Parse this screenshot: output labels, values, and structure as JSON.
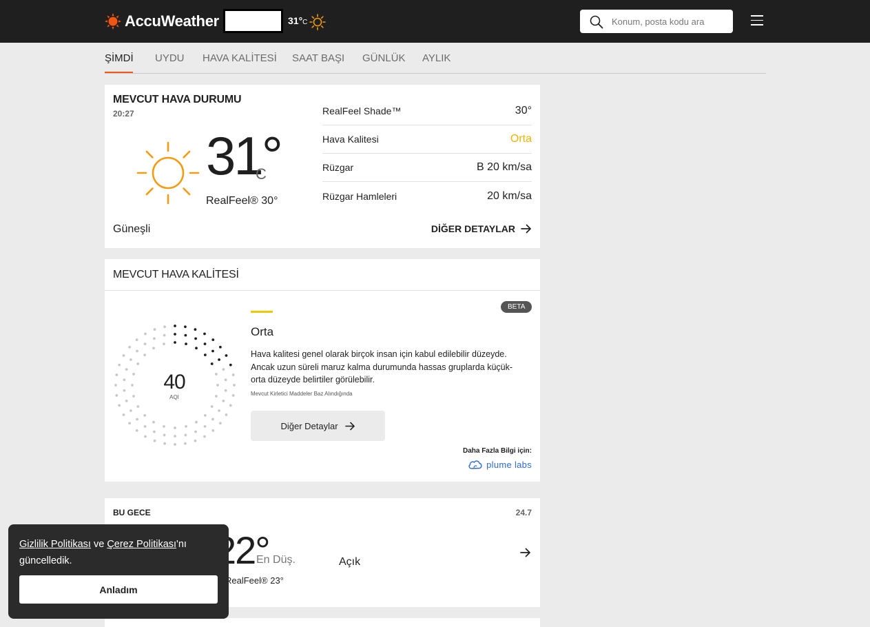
{
  "header": {
    "brand": "AccuWeather",
    "current_temp": "31°",
    "current_unit": "C",
    "search_placeholder": "Konum, posta kodu ara"
  },
  "nav": {
    "tabs": [
      {
        "label": "ŞİMDİ",
        "active": true
      },
      {
        "label": "UYDU",
        "active": false
      },
      {
        "label": "HAVA KALİTESİ",
        "active": false
      },
      {
        "label": "SAAT BAŞI",
        "active": false
      },
      {
        "label": "GÜNLÜK",
        "active": false
      },
      {
        "label": "AYLIK",
        "active": false
      }
    ]
  },
  "current": {
    "title": "MEVCUT HAVA DURUMU",
    "time": "20:27",
    "temp": "31°",
    "unit": "C",
    "realfeel": "RealFeel® 30°",
    "phrase": "Güneşli",
    "more_label": "DİĞER DETAYLAR",
    "details": [
      {
        "label": "RealFeel Shade™",
        "value": "30°"
      },
      {
        "label": "Hava Kalitesi",
        "value": "Orta"
      },
      {
        "label": "Rüzgar",
        "value": "B 20 km/sa"
      },
      {
        "label": "Rüzgar Hamleleri",
        "value": "20 km/sa"
      }
    ]
  },
  "air_quality": {
    "title": "MEVCUT HAVA KALİTESİ",
    "badge": "BETA",
    "aqi": "40",
    "aqi_label": "AQI",
    "aqi_fraction": 0.2,
    "level": "Orta",
    "level_color": "#f0c800",
    "description": "Hava kalitesi genel olarak birçok insan için kabul edilebilir düzeyde. Ancak uzun süreli maruz kalma durumunda hassas gruplarda küçük-orta düzeyde belirtiler görülebilir.",
    "source": "Mevcut Kirletici Maddeler Baz Alındığında",
    "button_label": "Diğer Detaylar",
    "more_info": "Daha Fazla Bilgi için:",
    "partner": "plume labs"
  },
  "tonight": {
    "title": "BU GECE",
    "date": "24.7",
    "temp": "22°",
    "low_label": "En Düş.",
    "realfeel": "RealFeel® 23°",
    "phrase": "Açık"
  },
  "cookie": {
    "privacy_link": "Gizlilik Politikası",
    "and_text": " ve ",
    "cookie_link": "Çerez Politikası",
    "suffix_text": "'nı güncelledik.",
    "button_label": "Anladım"
  },
  "colors": {
    "brand_orange": "#f05514",
    "sun_orange": "#f39c12",
    "header_bg": "#1f1f1f"
  }
}
